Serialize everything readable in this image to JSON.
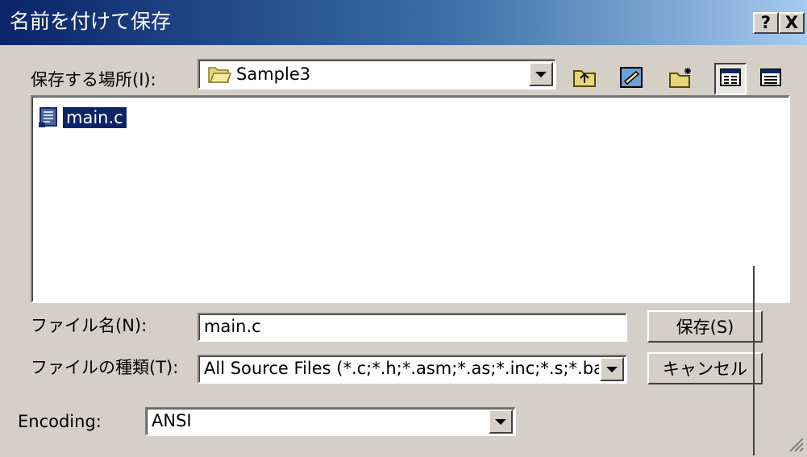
{
  "dialog": {
    "title": "名前を付けて保存",
    "help_button": "?",
    "close_button": "X"
  },
  "location": {
    "label": "保存する場所(I):",
    "value": "Sample3",
    "icon": "folder-open-icon"
  },
  "toolbar": {
    "buttons": [
      {
        "name": "up-one-level",
        "icon": "folder-up-icon"
      },
      {
        "name": "desktop",
        "icon": "desktop-icon"
      },
      {
        "name": "new-folder",
        "icon": "new-folder-icon"
      },
      {
        "name": "list-view",
        "icon": "list-view-icon"
      },
      {
        "name": "details-view",
        "icon": "details-view-icon"
      }
    ]
  },
  "file_list": {
    "items": [
      {
        "name": "main.c",
        "icon": "c-source-file-icon",
        "selected": true
      }
    ]
  },
  "filename": {
    "label": "ファイル名(N):",
    "value": "main.c"
  },
  "filetype": {
    "label": "ファイルの種類(T):",
    "value": "All Source Files (*.c;*.h;*.asm;*.as;*.inc;*.s;*.bas;*"
  },
  "encoding": {
    "label": "Encoding:",
    "value": "ANSI"
  },
  "buttons": {
    "save": "保存(S)",
    "cancel": "キャンセル"
  },
  "colors": {
    "titlebar_start": "#0a246a",
    "titlebar_end": "#a6caf0",
    "face": "#d4d0c8",
    "selection": "#0a246a"
  }
}
